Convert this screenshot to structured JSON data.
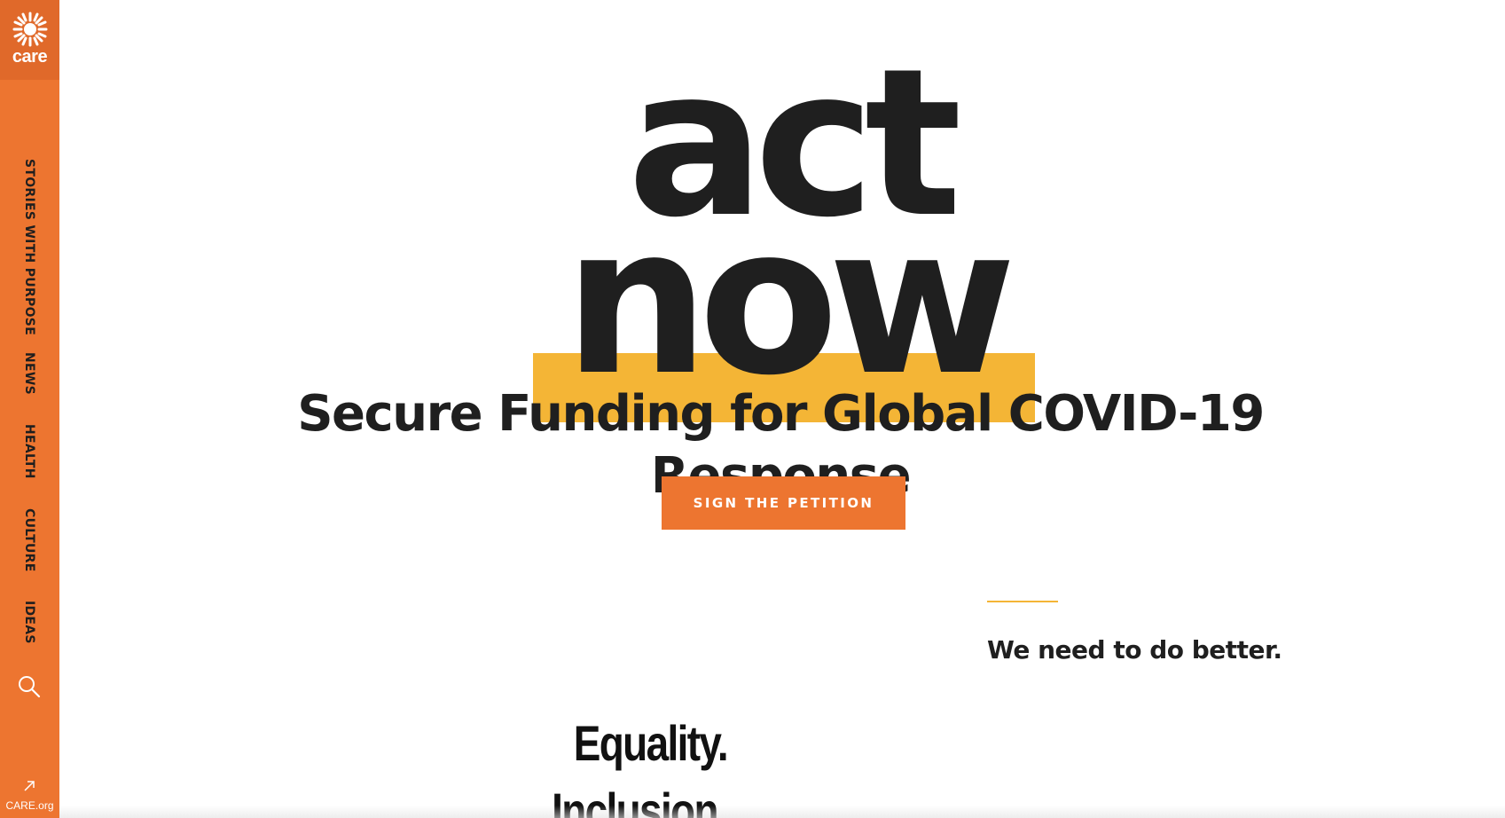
{
  "sidebar": {
    "logo_text": "care",
    "logo_icon": "care-sun-logo-icon",
    "nav_items": [
      {
        "label": "STORIES WITH PURPOSE"
      },
      {
        "label": "NEWS"
      },
      {
        "label": "HEALTH"
      },
      {
        "label": "CULTURE"
      },
      {
        "label": "IDEAS"
      }
    ],
    "search_icon": "search-icon",
    "external_link_icon": "arrow-up-right-icon",
    "external_link_label": "CARE.org"
  },
  "hero": {
    "word_1": "act",
    "word_2": "now",
    "subtitle": "Secure Funding for Global COVID-19 Response",
    "cta_label": "SIGN THE PETITION"
  },
  "content": {
    "heading": "We need to do better.",
    "values": [
      "Equality.",
      "Inclusion."
    ]
  },
  "colors": {
    "sidebar_orange": "#ed7530",
    "logo_orange": "#e0692a",
    "highlight_yellow": "#f4b536",
    "text_dark": "#1f1f1f"
  }
}
